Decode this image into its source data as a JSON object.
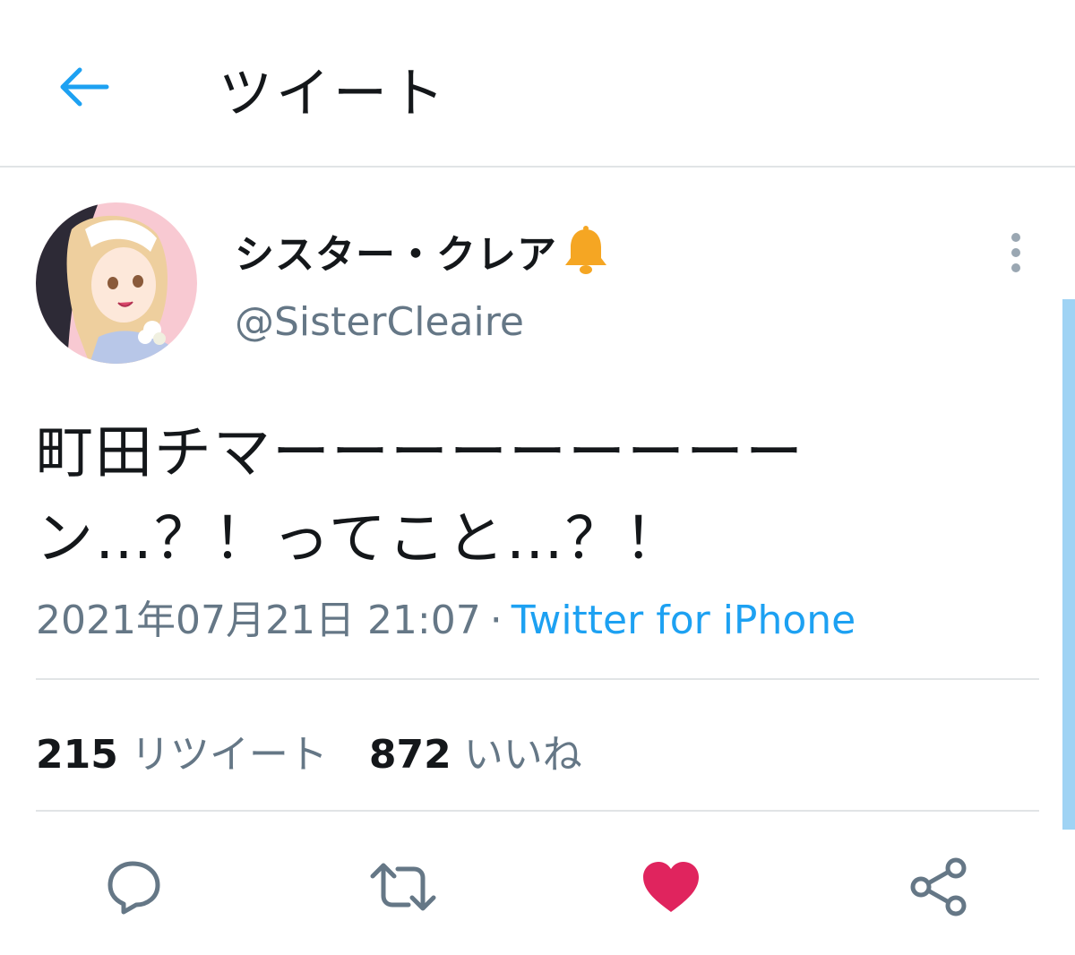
{
  "header": {
    "title": "ツイート",
    "back_icon": "arrow-left-icon"
  },
  "tweet": {
    "author": {
      "display_name": "シスター・クレア",
      "handle": "@SisterCleaire",
      "notification_icon": "bell-icon"
    },
    "text": "町田チマーーーーーーーーーン…？！ってこと…？！",
    "datetime": "2021年07月21日 21:07",
    "separator": "·",
    "source": "Twitter for iPhone"
  },
  "stats": {
    "retweets_count": "215",
    "retweets_label": "リツイート",
    "likes_count": "872",
    "likes_label": "いいね"
  },
  "actions": {
    "reply_icon": "reply-bubble-icon",
    "retweet_icon": "retweet-icon",
    "like_icon": "heart-icon",
    "share_icon": "share-icon",
    "liked": true
  },
  "colors": {
    "accent": "#1da1f2",
    "like": "#e0245e",
    "secondary_text": "#657786",
    "bell": "#f5a623"
  }
}
